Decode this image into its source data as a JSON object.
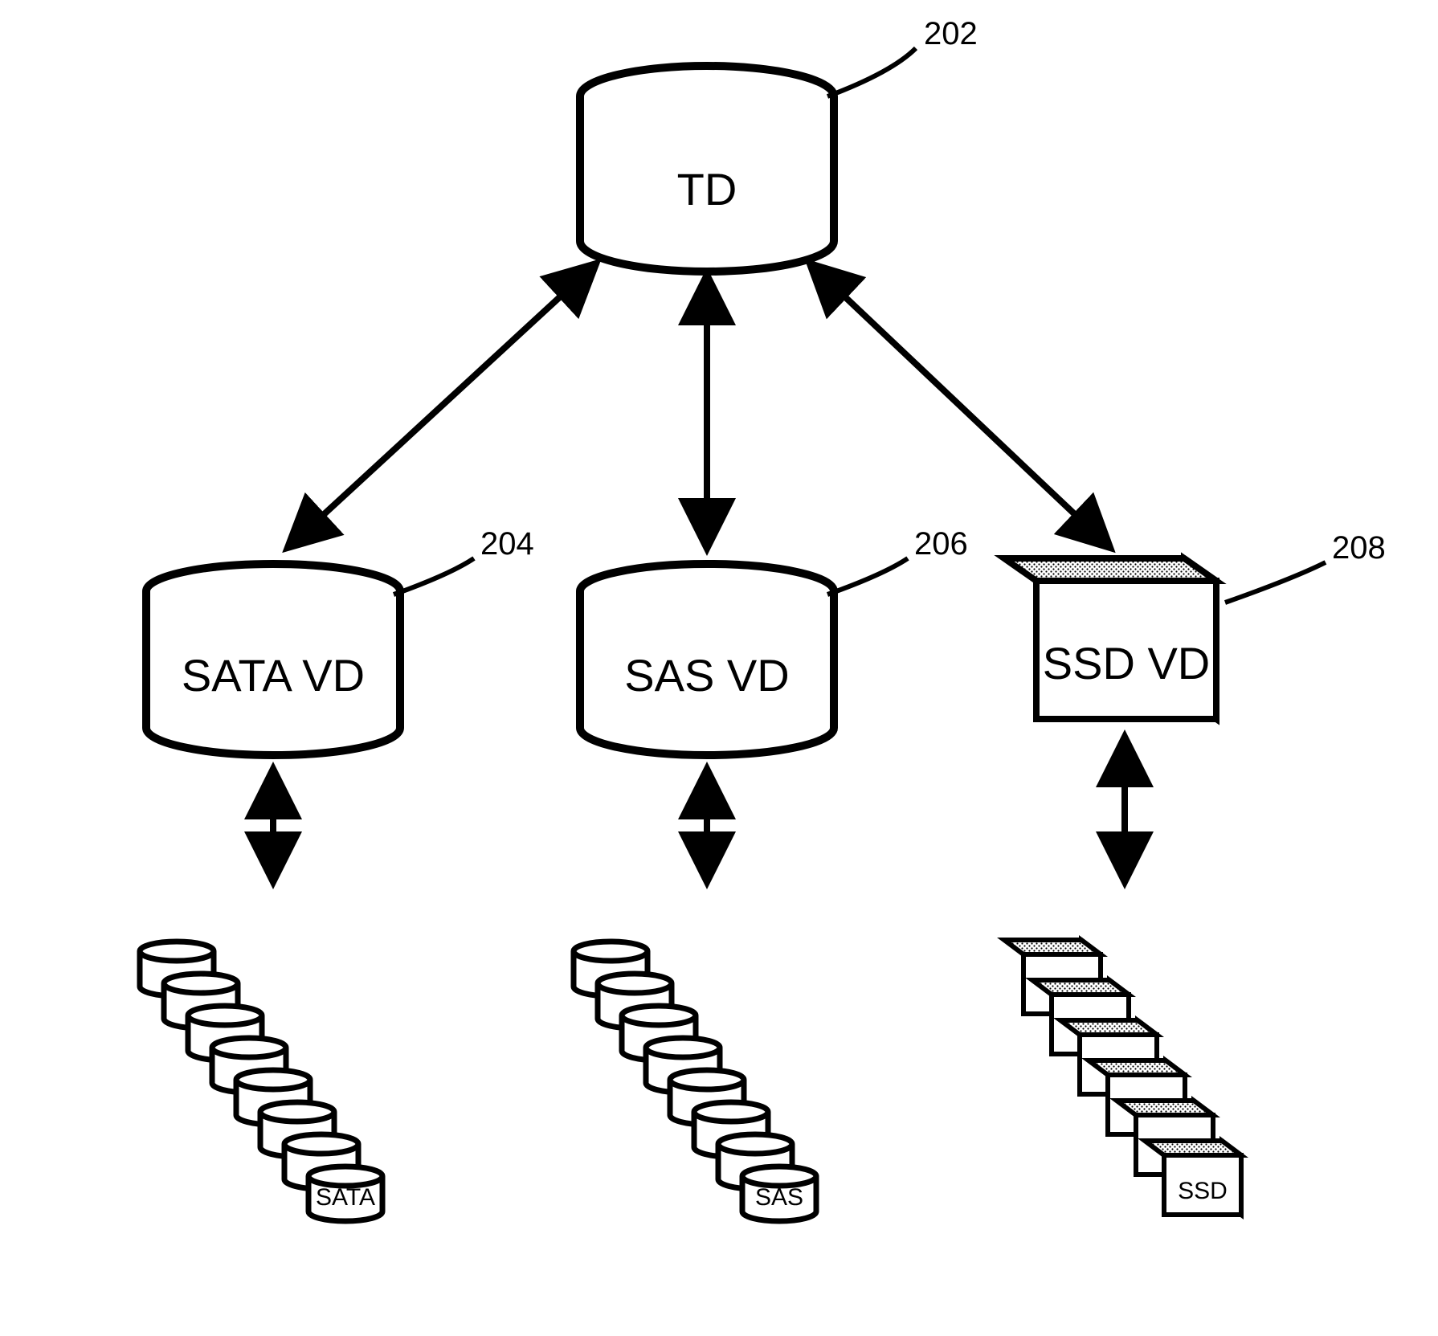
{
  "nodes": {
    "td": {
      "label": "TD",
      "ref": "202"
    },
    "sata_vd": {
      "label": "SATA VD",
      "ref": "204"
    },
    "sas_vd": {
      "label": "SAS VD",
      "ref": "206"
    },
    "ssd_vd": {
      "label": "SSD VD",
      "ref": "208"
    }
  },
  "arrays": {
    "sata": {
      "label": "SATA"
    },
    "sas": {
      "label": "SAS"
    },
    "ssd": {
      "label": "SSD"
    }
  }
}
